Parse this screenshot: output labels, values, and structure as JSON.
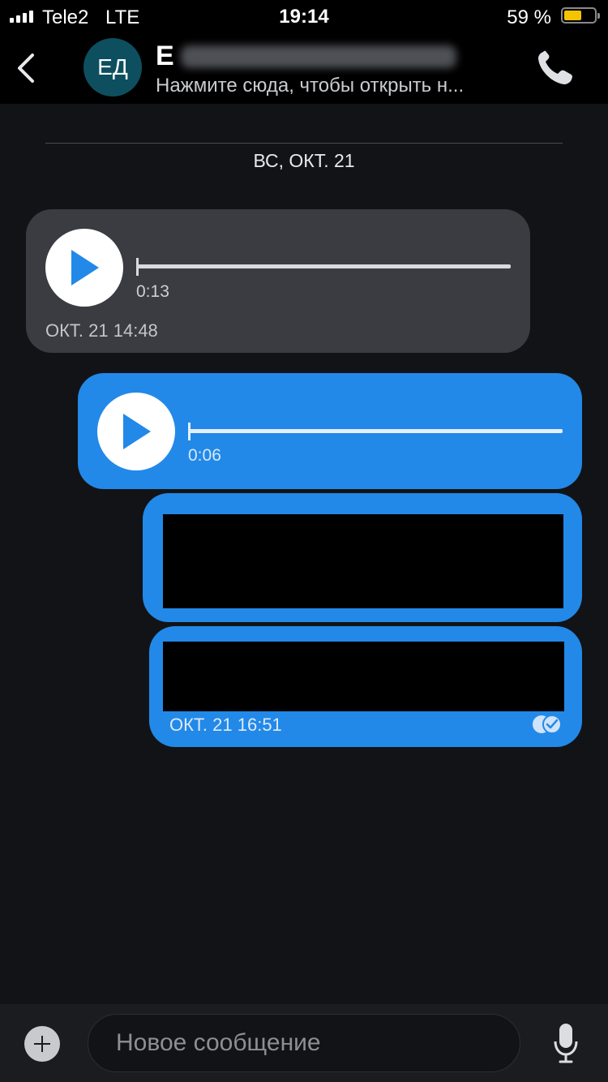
{
  "status_bar": {
    "carrier": "Tele2",
    "network": "LTE",
    "time": "19:14",
    "battery_percent": "59 %",
    "battery_level": 0.59,
    "battery_color": "#f5c400"
  },
  "header": {
    "avatar_initials": "ЕД",
    "name_visible": "Е",
    "subtitle": "Нажмите сюда, чтобы открыть н...",
    "back_icon": "chevron-left-icon",
    "call_icon": "phone-icon"
  },
  "chat": {
    "date_separator": "ВС, ОКТ. 21",
    "messages": [
      {
        "type": "voice",
        "direction": "incoming",
        "duration": "0:13",
        "timestamp": "ОКТ. 21 14:48"
      },
      {
        "type": "voice",
        "direction": "outgoing",
        "duration": "0:06"
      },
      {
        "type": "text",
        "direction": "outgoing",
        "redacted": true
      },
      {
        "type": "text",
        "direction": "outgoing",
        "redacted": true,
        "timestamp": "ОКТ. 21 16:51",
        "status_icon": "read-check-icon"
      }
    ]
  },
  "composer": {
    "placeholder": "Новое сообщение",
    "add_icon": "plus-icon",
    "mic_icon": "microphone-icon"
  },
  "colors": {
    "background": "#121316",
    "incoming_bubble": "#3b3c41",
    "outgoing_bubble": "#2289e8",
    "play_arrow": "#2289e8",
    "avatar": "#0d4f5f"
  }
}
